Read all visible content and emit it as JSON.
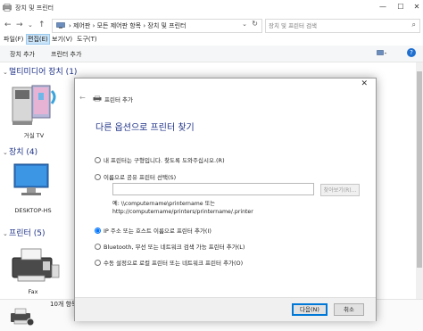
{
  "window": {
    "title": "장치 및 프린터"
  },
  "address": {
    "breadcrumb": "›  제어판  ›  모든 제어판 항목  ›  장치 및 프린터",
    "search_placeholder": "장치 및 프린터 검색"
  },
  "menu": {
    "items": [
      "파일(F)",
      "편집(E)",
      "보기(V)",
      "도구(T)"
    ]
  },
  "toolbar": {
    "add_device": "장치 추가",
    "add_printer": "프린터 추가"
  },
  "groups": {
    "multimedia": "멀티미디어 장치 (1)",
    "devices": "장치 (4)",
    "printers": "프린터 (5)"
  },
  "devices": {
    "tv_label": "거실 TV",
    "pc_label": "DESKTOP-HS",
    "printer_label": "Fax"
  },
  "status": {
    "count_text": "10개 항목"
  },
  "dialog": {
    "title": "프린터 추가",
    "heading": "다른 옵션으로 프린터 찾기",
    "option1": "내 프린터는 구형입니다. 찾도록 도와주십시오.(R)",
    "option2": "이름으로 공유 프린터 선택(S)",
    "browse": "찾아보기(R)...",
    "example_line1": "예: \\\\computername\\printername 또는",
    "example_line2": "http://computername/printers/printername/.printer",
    "option3": "IP 주소 또는 호스트 이름으로 프린터 추가(I)",
    "option4": "Bluetooth, 무선 또는 네트워크 검색 가능 프린터 추가(L)",
    "option5": "수동 설정으로 로컬 프린터 또는 네트워크 프린터 추가(O)",
    "next": "다음(N)",
    "cancel": "취소",
    "selected_option": 3
  },
  "colors": {
    "heading_blue": "#1e3287",
    "accent": "#0078d7"
  }
}
